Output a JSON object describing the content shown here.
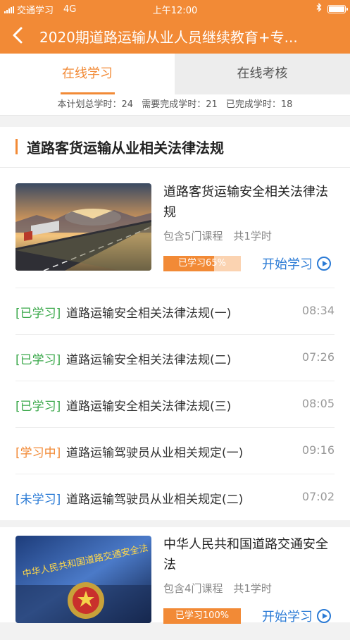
{
  "status_bar": {
    "carrier": "交通学习",
    "network": "4G",
    "time": "上午12:00"
  },
  "nav": {
    "title": "2020期道路运输从业人员继续教育+专..."
  },
  "tabs": [
    {
      "label": "在线学习"
    },
    {
      "label": "在线考核"
    }
  ],
  "summary": {
    "total": "本计划总学时：24",
    "required": "需要完成学时：21",
    "completed": "已完成学时：18"
  },
  "section": {
    "title": "道路客货运输从业相关法律法规"
  },
  "courses": [
    {
      "title": "道路客货运输安全相关法律法规",
      "meta_courses": "包含5门课程",
      "meta_hours": "共1学时",
      "progress_label": "已学习65%",
      "progress": 0.65,
      "start_label": "开始学习",
      "lessons": [
        {
          "status": "[已学习]",
          "name": "道路运输安全相关法律法规(一)",
          "duration": "08:34"
        },
        {
          "status": "[已学习]",
          "name": "道路运输安全相关法律法规(二)",
          "duration": "07:26"
        },
        {
          "status": "[已学习]",
          "name": "道路运输安全相关法律法规(三)",
          "duration": "08:05"
        },
        {
          "status": "[学习中]",
          "name": "道路运输驾驶员从业相关规定(一)",
          "duration": "09:16"
        },
        {
          "status": "[未学习]",
          "name": "道路运输驾驶员从业相关规定(二)",
          "duration": "07:02"
        }
      ]
    },
    {
      "title": "中华人民共和国道路交通安全法",
      "meta_courses": "包含4门课程",
      "meta_hours": "共1学时",
      "progress_label": "已学习100%",
      "progress": 1.0,
      "start_label": "开始学习",
      "thumb_text": "中华人民共和国道路交通安全法"
    }
  ],
  "colors": {
    "accent": "#f28a36",
    "link": "#2a7ad5",
    "done": "#3aa84a"
  }
}
